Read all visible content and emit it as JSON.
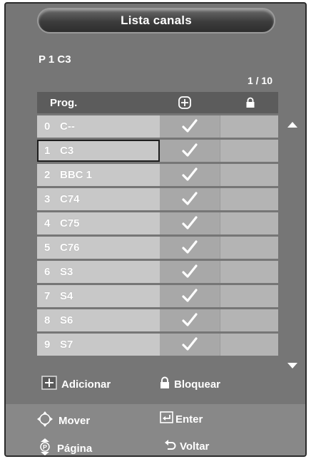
{
  "title": "Lista canals",
  "current_channel": "P  1  C3",
  "page_indicator": "1 / 10",
  "table": {
    "header": {
      "prog": "Prog.",
      "add_icon": "add-icon",
      "lock_icon": "lock-icon"
    },
    "rows": [
      {
        "num": "0",
        "name": "C--",
        "added": true,
        "locked": false
      },
      {
        "num": "1",
        "name": "C3",
        "added": true,
        "locked": false,
        "selected": true
      },
      {
        "num": "2",
        "name": "BBC 1",
        "added": true,
        "locked": false
      },
      {
        "num": "3",
        "name": "C74",
        "added": true,
        "locked": false
      },
      {
        "num": "4",
        "name": "C75",
        "added": true,
        "locked": false
      },
      {
        "num": "5",
        "name": "C76",
        "added": true,
        "locked": false
      },
      {
        "num": "6",
        "name": "S3",
        "added": true,
        "locked": false
      },
      {
        "num": "7",
        "name": "S4",
        "added": true,
        "locked": false
      },
      {
        "num": "8",
        "name": "S6",
        "added": true,
        "locked": false
      },
      {
        "num": "9",
        "name": "S7",
        "added": true,
        "locked": false
      }
    ]
  },
  "legend": {
    "add_label": "Adicionar",
    "lock_label": "Bloquear"
  },
  "footer": {
    "move_label": "Mover",
    "enter_label": "Enter",
    "page_label": "Página",
    "back_label": "Voltar"
  },
  "colors": {
    "panel": "#767676",
    "cell_light": "#c8c8c8",
    "cell_mid": "#a8a8a8",
    "footer": "#888888"
  }
}
